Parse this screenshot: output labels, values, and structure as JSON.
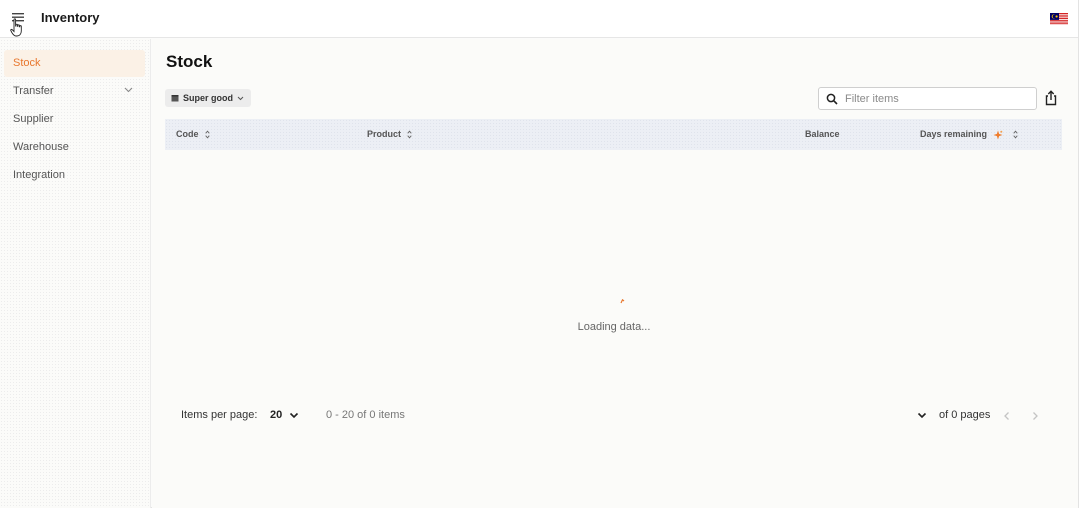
{
  "header": {
    "title": "Inventory",
    "menu_icon": "hamburger-menu-icon",
    "flag_icon": "malaysia-flag-icon"
  },
  "sidebar": {
    "items": [
      {
        "label": "Stock",
        "active": true
      },
      {
        "label": "Transfer",
        "expandable": true
      },
      {
        "label": "Supplier"
      },
      {
        "label": "Warehouse"
      },
      {
        "label": "Integration"
      }
    ]
  },
  "main": {
    "title": "Stock",
    "filter_chip": {
      "label": "Super good",
      "icon": "warehouse-icon"
    },
    "search": {
      "placeholder": "Filter items",
      "value": ""
    },
    "share_icon": "share-export-icon"
  },
  "table": {
    "columns": [
      {
        "label": "Code",
        "sortable": true
      },
      {
        "label": "Product",
        "sortable": true
      },
      {
        "label": "Balance",
        "sortable": false
      },
      {
        "label": "Days remaining",
        "sortable": true,
        "badge_icon": "ai-sparkle-icon"
      }
    ],
    "rows": []
  },
  "loading": {
    "text": "Loading data..."
  },
  "pagination": {
    "items_per_page_label": "Items per page:",
    "items_per_page": "20",
    "range_text": "0 - 20 of 0 items",
    "pages_text": "of 0 pages"
  },
  "colors": {
    "accent": "#e8772e",
    "active_bg": "#fbf1e6",
    "table_header_bg": "#eceff5"
  }
}
